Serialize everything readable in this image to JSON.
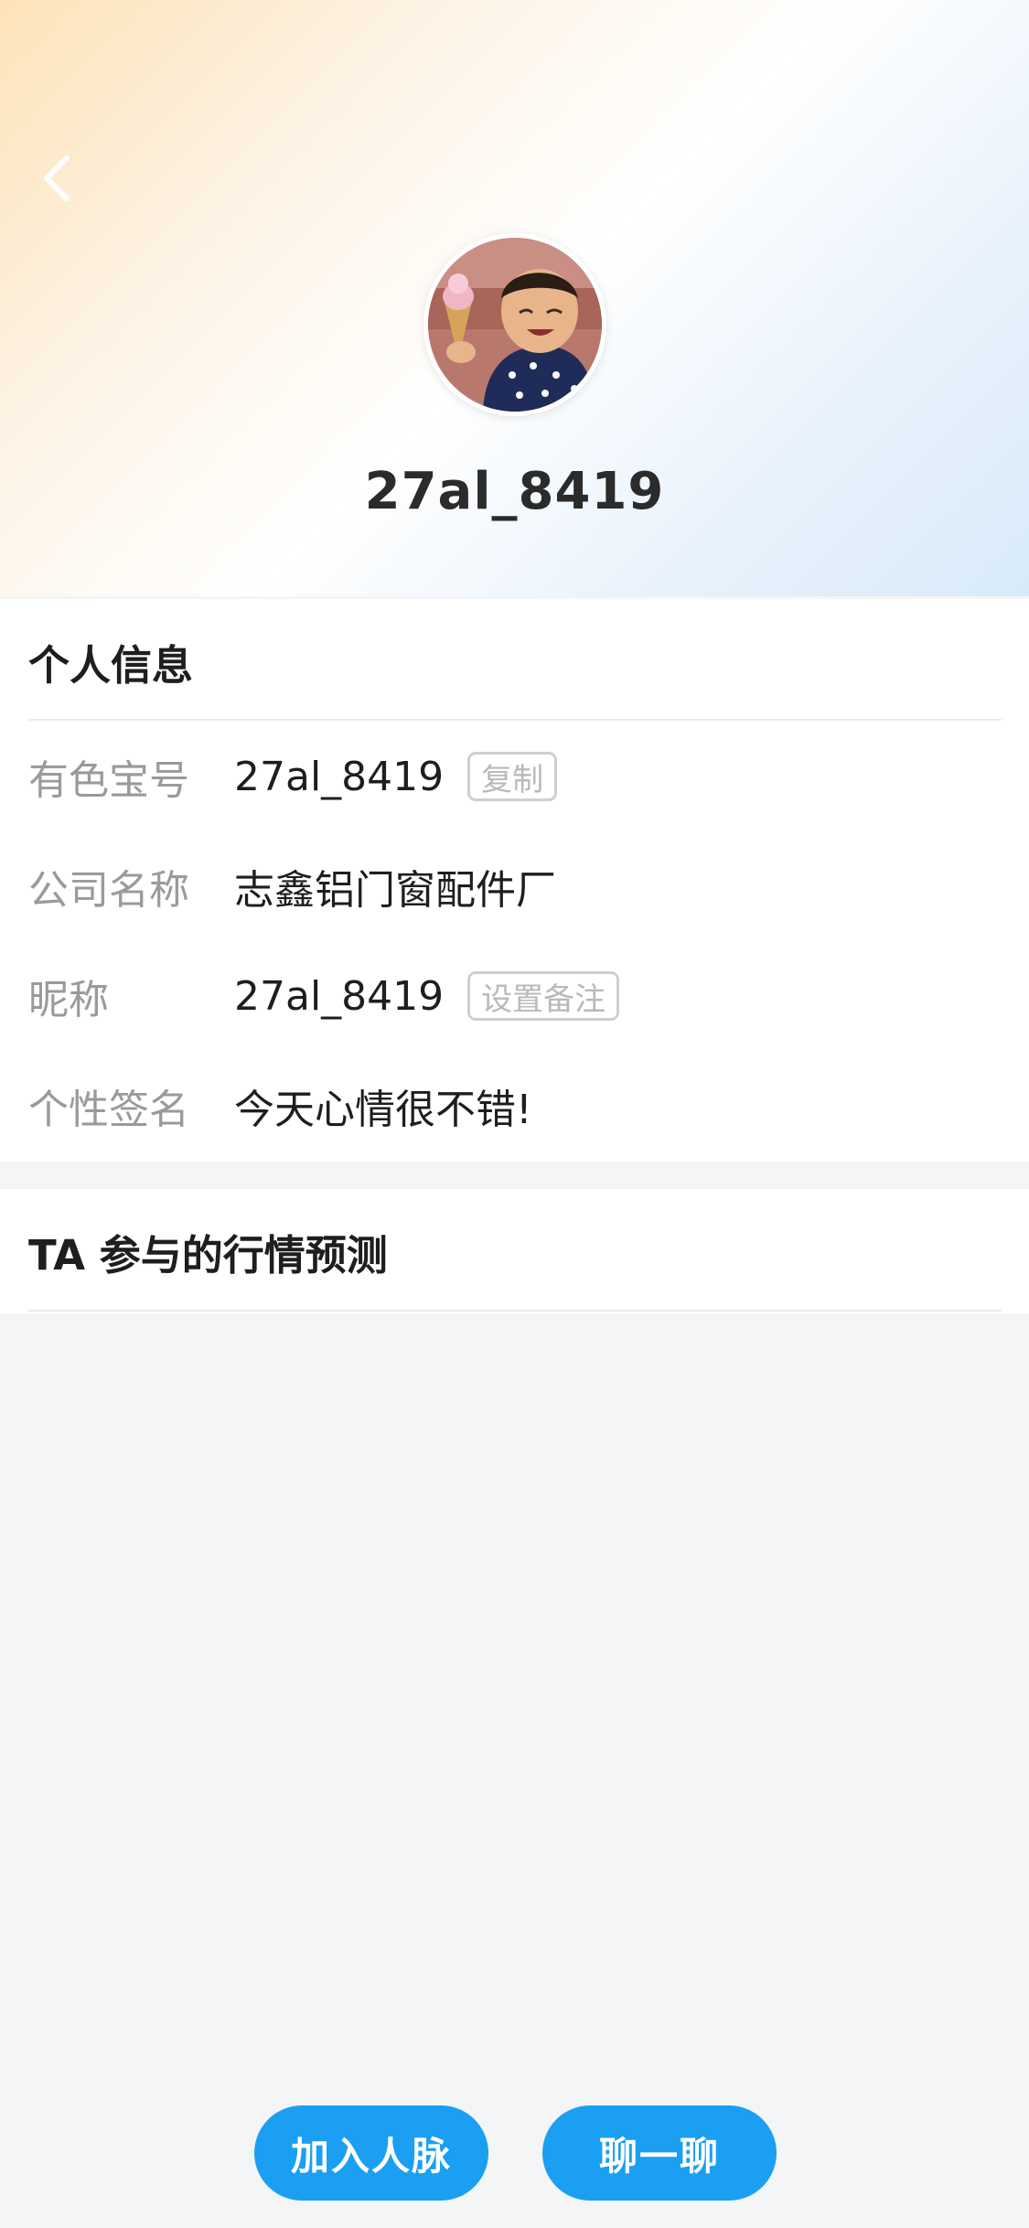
{
  "profile": {
    "username": "27al_8419",
    "avatar_icon": "child-with-ice-cream-photo"
  },
  "nav": {
    "back_icon": "chevron-left-icon"
  },
  "info_section": {
    "title": "个人信息",
    "rows": [
      {
        "label": "有色宝号",
        "value": "27al_8419",
        "chip": "复制"
      },
      {
        "label": "公司名称",
        "value": "志鑫铝门窗配件厂"
      },
      {
        "label": "昵称",
        "value": "27al_8419",
        "chip": "设置备注"
      },
      {
        "label": "个性签名",
        "value": "今天心情很不错!"
      }
    ]
  },
  "prediction_section": {
    "title": "TA 参与的行情预测"
  },
  "actions": {
    "add_contact": "加入人脉",
    "chat": "聊一聊"
  },
  "colors": {
    "primary": "#1b9ff3",
    "background": "#f4f5f7",
    "label_gray": "#9a9a9a"
  }
}
